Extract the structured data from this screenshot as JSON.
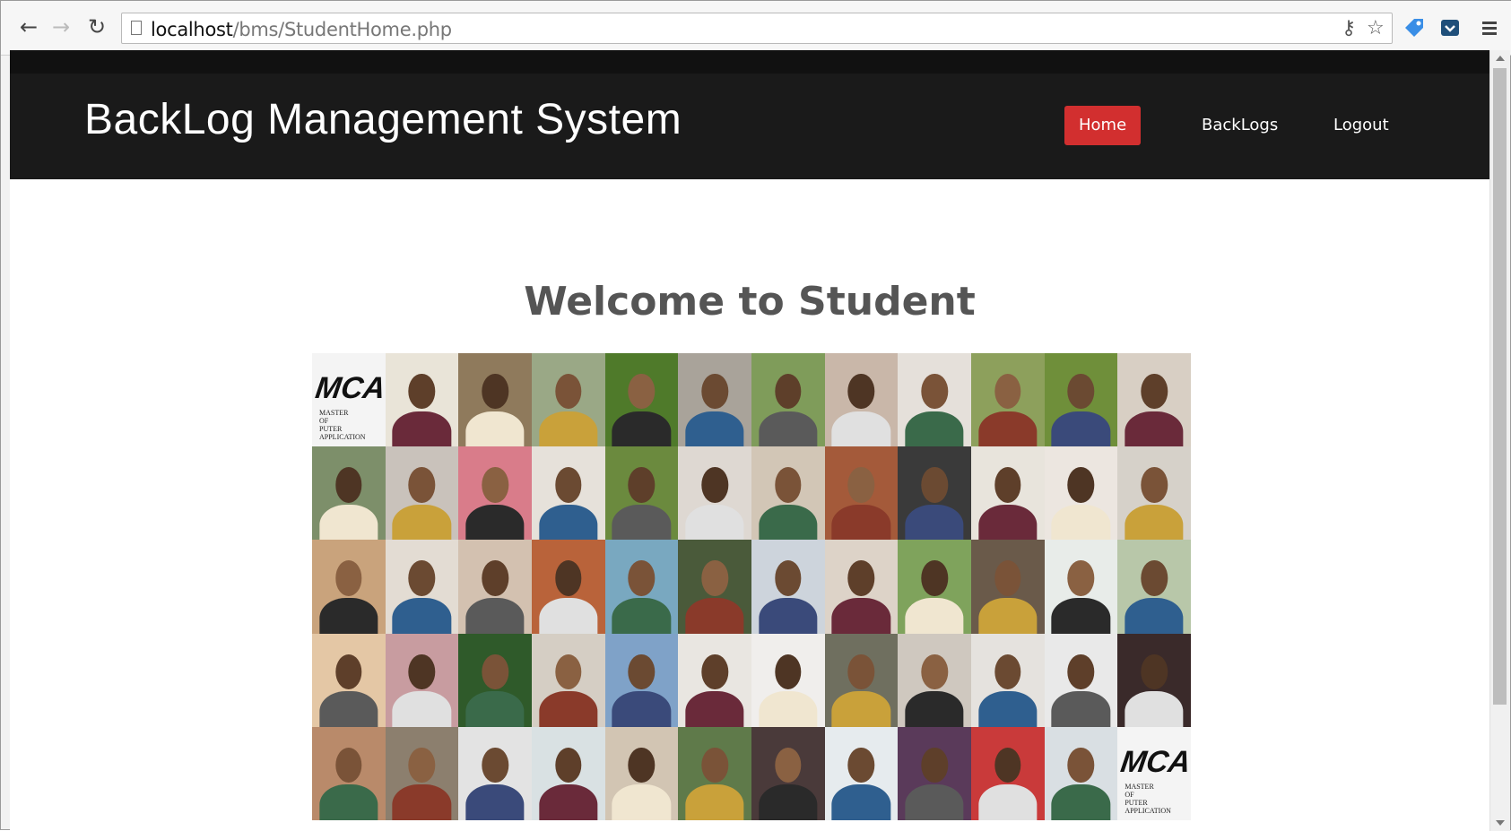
{
  "browser": {
    "url_host": "localhost",
    "url_path": "/bms/StudentHome.php"
  },
  "header": {
    "brand": "BackLog Management System",
    "nav": [
      {
        "label": "Home",
        "active": true
      },
      {
        "label": "BackLogs",
        "active": false
      },
      {
        "label": "Logout",
        "active": false
      }
    ]
  },
  "main": {
    "welcome": "Welcome to Student",
    "mca_logo": "MCA",
    "mca_sub": [
      "MASTER",
      "OF",
      "PUTER APPLICATION"
    ]
  },
  "colors": {
    "header_bg": "#1a1a1a",
    "active_nav": "#d22f2f",
    "welcome_text": "#555555"
  }
}
